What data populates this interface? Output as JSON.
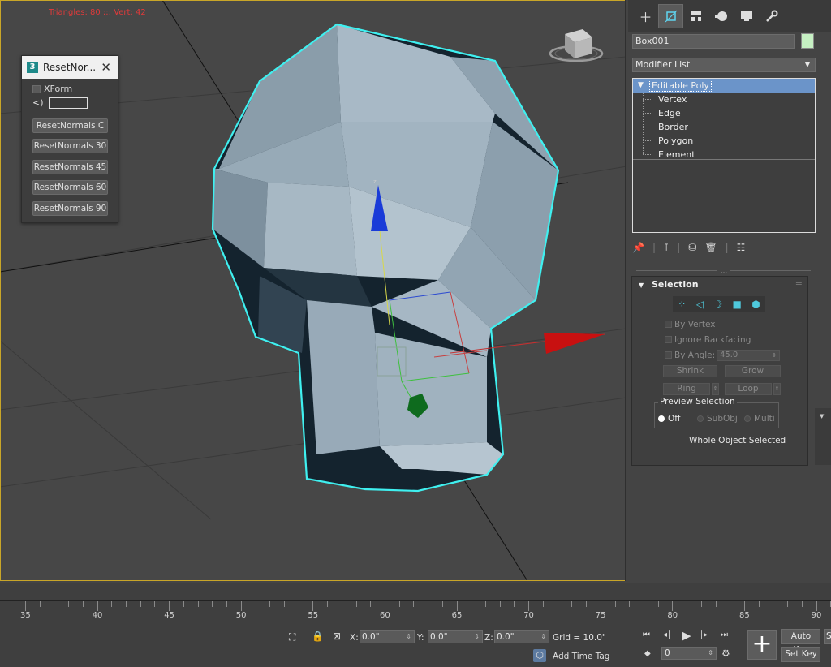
{
  "viewport": {
    "stats": "Triangles: 80 ::: Vert: 42"
  },
  "reset_dialog": {
    "title": "ResetNor...",
    "xform_label": "XForm",
    "edit_prefix": "<)",
    "buttons": [
      "ResetNormals C",
      "ResetNormals 30",
      "ResetNormals 45",
      "ResetNormals 60",
      "ResetNormals 90"
    ]
  },
  "panel": {
    "tabs": [
      "create-icon",
      "modify-icon",
      "hierarchy-icon",
      "motion-icon",
      "display-icon",
      "utilities-icon"
    ],
    "object_name": "Box001",
    "object_color": "#c6f0c3",
    "modifier_list": "Modifier List",
    "stack": {
      "root": "Editable Poly",
      "items": [
        "Vertex",
        "Edge",
        "Border",
        "Polygon",
        "Element"
      ]
    },
    "selection": {
      "title": "Selection",
      "by_vertex": "By Vertex",
      "ignore_backfacing": "Ignore Backfacing",
      "by_angle": "By Angle:",
      "angle_value": "45.0",
      "shrink": "Shrink",
      "grow": "Grow",
      "ring": "Ring",
      "loop": "Loop",
      "preview_title": "Preview Selection",
      "preview_off": "Off",
      "preview_subobj": "SubObj",
      "preview_multi": "Multi",
      "status": "Whole Object Selected"
    }
  },
  "timeline": {
    "labels": [
      "35",
      "40",
      "45",
      "50",
      "55",
      "60",
      "65",
      "70",
      "75",
      "80",
      "85",
      "90"
    ]
  },
  "bottom": {
    "x_label": "X:",
    "x_value": "0.0\"",
    "y_label": "Y:",
    "y_value": "0.0\"",
    "z_label": "Z:",
    "z_value": "0.0\"",
    "grid": "Grid = 10.0\"",
    "add_time_tag": "Add Time Tag",
    "frame_value": "0",
    "auto_key": "Auto Key",
    "set_key": "Set Key",
    "sel_partial": "S"
  },
  "colors": {
    "accent": "#5fd4f0",
    "selection_outline": "#3ff0f0",
    "stack_highlight": "#6b94c9"
  }
}
